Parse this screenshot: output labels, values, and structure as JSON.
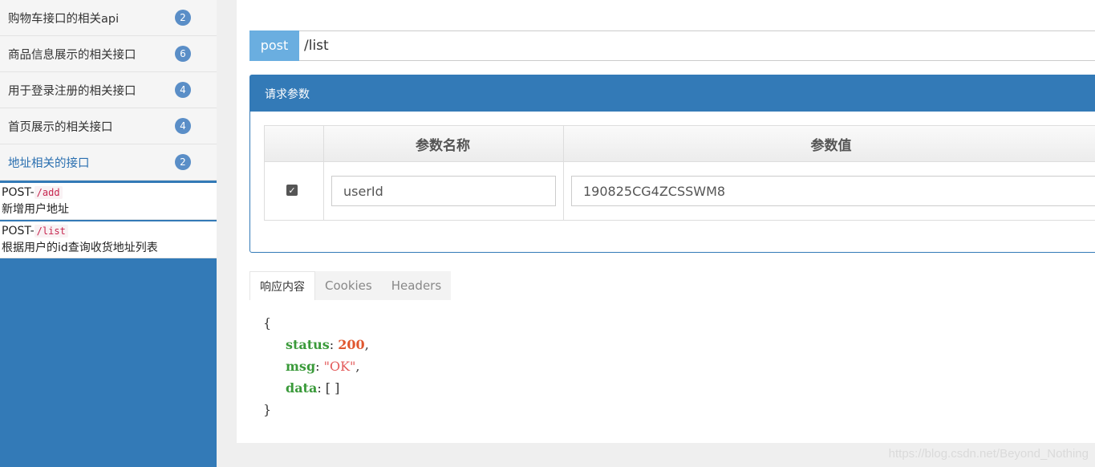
{
  "sidebar": {
    "groups": [
      {
        "label": "购物车接口的相关api",
        "count": "2"
      },
      {
        "label": "商品信息展示的相关接口",
        "count": "6"
      },
      {
        "label": "用于登录注册的相关接口",
        "count": "4"
      },
      {
        "label": "首页展示的相关接口",
        "count": "4"
      },
      {
        "label": "地址相关的接口",
        "count": "2"
      }
    ],
    "endpoints": [
      {
        "method": "POST-",
        "path": "/add",
        "desc": "新增用户地址"
      },
      {
        "method": "POST-",
        "path": "/list",
        "desc": "根据用户的id查询收货地址列表"
      }
    ]
  },
  "request": {
    "method": "post",
    "url": "/list"
  },
  "params_panel": {
    "title": "请求参数",
    "headers": [
      "参数名称",
      "参数值"
    ],
    "rows": [
      {
        "checked": true,
        "name": "userId",
        "value": "190825CG4ZCSSWM8"
      }
    ]
  },
  "response": {
    "tabs": [
      "响应内容",
      "Cookies",
      "Headers"
    ],
    "json": {
      "open": "{",
      "close": "}",
      "status_key": "status",
      "status_val": "200",
      "msg_key": "msg",
      "msg_val": "\"OK\"",
      "data_key": "data",
      "data_val": "[ ]"
    }
  },
  "watermark": "https://blog.csdn.net/Beyond_Nothing",
  "colors": {
    "accent": "#337ab7",
    "method": "#6aaee0",
    "badge": "#5a8ec7"
  }
}
